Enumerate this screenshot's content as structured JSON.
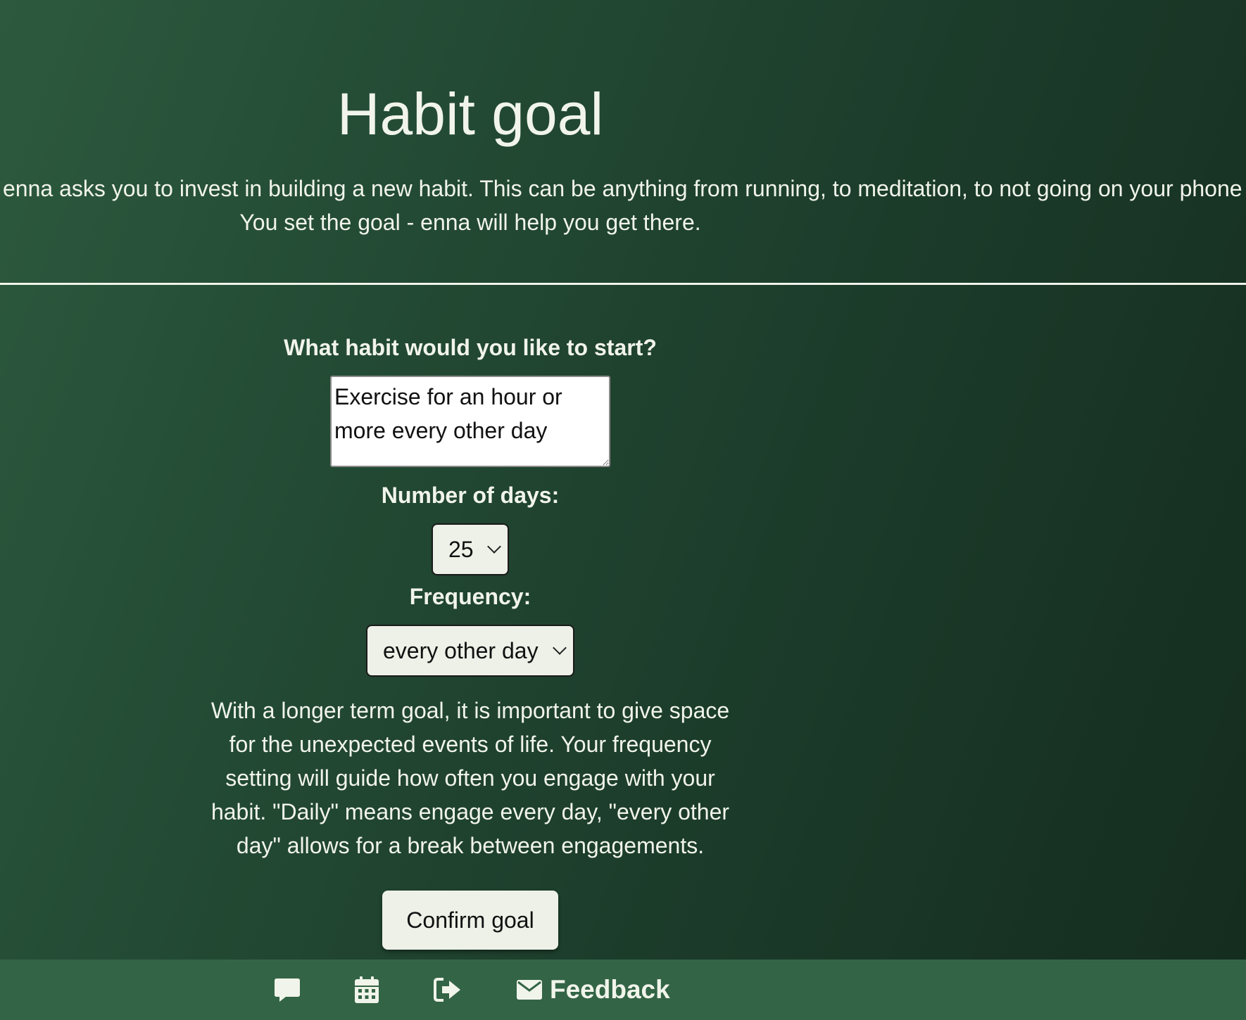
{
  "page": {
    "title": "Habit goal",
    "intro_line1": "enna asks you to invest in building a new habit. This can be anything from running, to meditation, to not going on your phone",
    "intro_line2": "You set the goal - enna will help you get there."
  },
  "form": {
    "habit_label": "What habit would you like to start?",
    "habit_value": "Exercise for an hour or more every other day",
    "days_label": "Number of days:",
    "days_value": "25",
    "frequency_label": "Frequency:",
    "frequency_value": "every other day",
    "explanation": "With a longer term goal, it is important to give space for the unexpected events of life. Your frequency setting will guide how often you engage with your habit. \"Daily\" means engage every day, \"every other day\" allows for a break between engagements.",
    "confirm_label": "Confirm goal"
  },
  "footer": {
    "icons": [
      "chat-icon",
      "calendar-icon",
      "logout-icon",
      "envelope-icon"
    ],
    "feedback_label": "Feedback"
  },
  "colors": {
    "background_start": "#2d5a3f",
    "background_end": "#142c1e",
    "footer": "#336446",
    "text": "#f1f4ea",
    "control": "#eef1e8"
  }
}
